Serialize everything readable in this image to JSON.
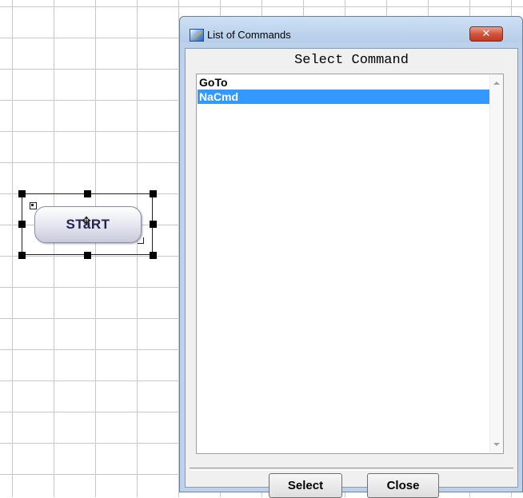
{
  "canvas": {
    "start_node_label": "STaRT"
  },
  "dialog": {
    "title": "List of Commands",
    "close_glyph": "✕",
    "header": "Select Command",
    "commands": [
      {
        "label": "GoTo",
        "selected": false
      },
      {
        "label": "NaCmd",
        "selected": true
      }
    ],
    "select_label": "Select",
    "close_label": "Close"
  },
  "colors": {
    "selection": "#3399ff",
    "dialog_frame": "#bcd2ec",
    "close_button": "#c03a22"
  }
}
